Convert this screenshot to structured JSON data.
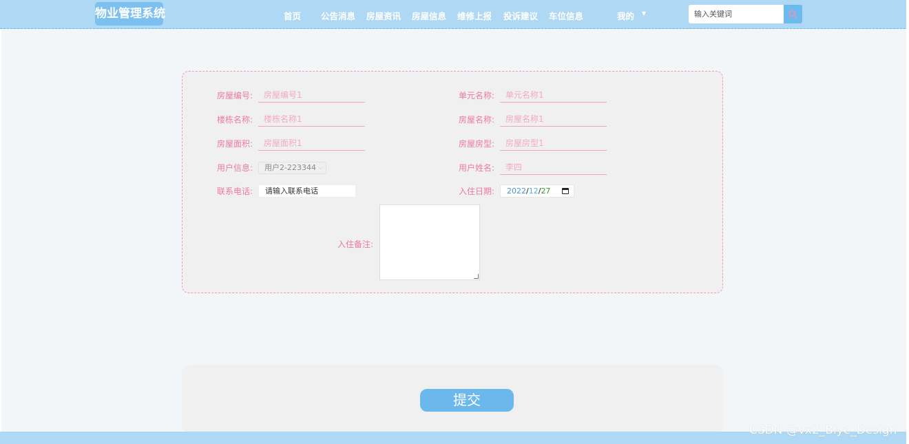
{
  "header": {
    "logo": "物业管理系统",
    "nav": [
      {
        "label": "首页"
      },
      {
        "label": "公告消息"
      },
      {
        "label": "房屋资讯"
      },
      {
        "label": "房屋信息"
      },
      {
        "label": "维修上报"
      },
      {
        "label": "投诉建议"
      },
      {
        "label": "车位信息"
      },
      {
        "label": "我的"
      }
    ],
    "search_placeholder": "输入关键词"
  },
  "form": {
    "house_no_label": "房屋编号:",
    "house_no_value": "房屋编号1",
    "unit_name_label": "单元名称:",
    "unit_name_value": "单元名称1",
    "building_label": "楼栋名称:",
    "building_value": "楼栋名称1",
    "house_name_label": "房屋名称:",
    "house_name_value": "房屋名称1",
    "area_label": "房屋面积:",
    "area_value": "房屋面积1",
    "house_type_label": "房屋房型:",
    "house_type_value": "房屋房型1",
    "user_info_label": "用户信息:",
    "user_info_value": "用户2-223344",
    "user_name_label": "用户姓名:",
    "user_name_value": "李四",
    "phone_label": "联系电话:",
    "phone_placeholder": "请输入联系电话",
    "checkin_label": "入住日期:",
    "checkin_year": "2022",
    "checkin_month": "12",
    "checkin_day": "27",
    "date_sep": "/",
    "remark_label": "入住备注:"
  },
  "submit_label": "提交",
  "watermark": "CSDN @vx2_Biye_Design",
  "colors": {
    "header_bg": "#aed8f3",
    "accent_blue": "#6bb8ec",
    "label_pink": "#ec7b9d"
  }
}
